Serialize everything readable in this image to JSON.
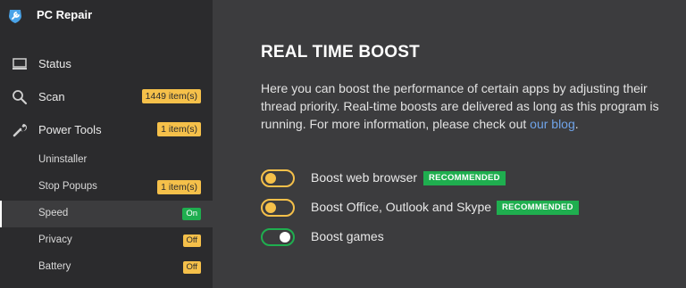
{
  "app": {
    "title": "PC Repair",
    "logo_icon": "wrench-shield-logo"
  },
  "sidebar": {
    "main_items": [
      {
        "label": "Status",
        "icon": "monitor-icon"
      },
      {
        "label": "Scan",
        "icon": "magnifier-icon",
        "badge": "1449 item(s)"
      },
      {
        "label": "Power Tools",
        "icon": "wrench-icon",
        "badge": "1 item(s)"
      }
    ],
    "sub_items": [
      {
        "label": "Uninstaller"
      },
      {
        "label": "Stop Popups",
        "badge": "1 item(s)"
      },
      {
        "label": "Speed",
        "state": "On",
        "active": true
      },
      {
        "label": "Privacy",
        "state": "Off"
      },
      {
        "label": "Battery",
        "state": "Off"
      }
    ]
  },
  "main": {
    "title": "REAL TIME BOOST",
    "description_before_link": "Here you can boost the performance of certain apps by adjusting their thread priority. Real-time boosts are delivered as long as this program is running. For more information, please check out ",
    "link_text": "our blog",
    "description_after_link": ".",
    "options": [
      {
        "label": "Boost web browser",
        "enabled": false,
        "tag": "RECOMMENDED"
      },
      {
        "label": "Boost Office, Outlook and Skype",
        "enabled": false,
        "tag": "RECOMMENDED"
      },
      {
        "label": "Boost games",
        "enabled": true
      }
    ]
  },
  "colors": {
    "sidebar_bg": "#2b2b2d",
    "main_bg": "#3c3c3e",
    "accent_yellow": "#f5c04a",
    "accent_green": "#1fae4f",
    "link_blue": "#6fa3e8"
  }
}
